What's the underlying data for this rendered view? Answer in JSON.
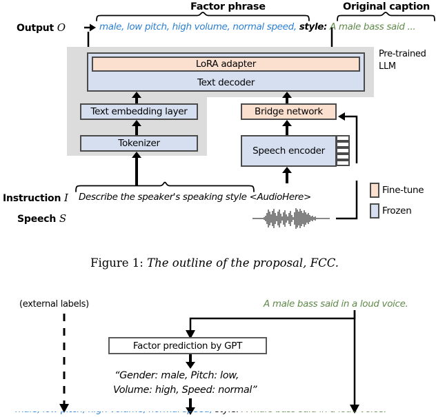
{
  "figure": {
    "caption_prefix": "Figure 1:",
    "caption_text": "The outline of the proposal, FCC.",
    "top_braces": [
      {
        "label": "Factor phrase"
      },
      {
        "label": "Original caption"
      }
    ],
    "row_labels": {
      "output": "Output",
      "output_symbol": "O",
      "instruction": "Instruction",
      "instruction_symbol": "I",
      "speech": "Speech",
      "speech_symbol": "S"
    },
    "output_line": {
      "factor_phrase": "male, low pitch, high volume, normal speed,",
      "style_keyword": "style:",
      "original_caption": "A male bass said ...",
      "factor_color": "#2a7fd4",
      "caption_color": "#5f8a4a"
    },
    "instruction_line": {
      "text": "Describe the speaker's speaking style <AudioHere>"
    },
    "llm_group": {
      "label_line1": "Pre-trained",
      "label_line2": "LLM",
      "blocks": [
        {
          "name": "lora",
          "label": "LoRA adapter",
          "fill": "#fbe0cf"
        },
        {
          "name": "text-decoder",
          "label": "Text decoder",
          "fill": "#d5dff0"
        },
        {
          "name": "text-embedding",
          "label": "Text embedding layer",
          "fill": "#d5dff0"
        },
        {
          "name": "tokenizer",
          "label": "Tokenizer",
          "fill": "#d5dff0"
        }
      ]
    },
    "speech_branch": {
      "bridge": {
        "label": "Bridge network",
        "fill": "#fbe0cf"
      },
      "encoder": {
        "label": "Speech encoder",
        "fill": "#d5dff0"
      }
    },
    "legend": [
      {
        "label": "Fine-tune",
        "color": "#fbe0cf"
      },
      {
        "label": "Frozen",
        "color": "#d5dff0"
      }
    ]
  },
  "figure2": {
    "external_labels": "(external labels)",
    "caption_green": "A male bass said in a loud voice.",
    "gpt_box": "Factor prediction by GPT",
    "gpt_output_line1": "“Gender: male, Pitch: low,",
    "gpt_output_line2": "Volume: high, Speed: normal”"
  }
}
